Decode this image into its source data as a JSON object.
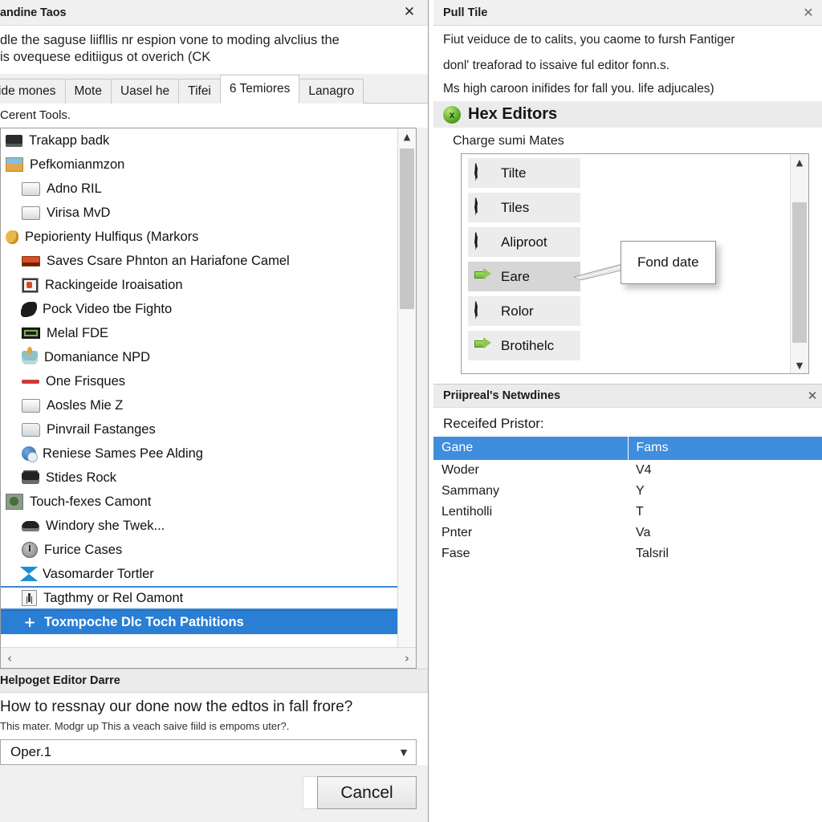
{
  "left_dialog": {
    "title": "andine Taos",
    "close_icon": "close-icon",
    "intro_lines": [
      "dle the saguse liifllis nr espion vone to moding alvclius the",
      "is ovequese editiigus ot overich (CK"
    ],
    "tabs": [
      {
        "label": "ide mones",
        "active": false
      },
      {
        "label": "Mote",
        "active": false
      },
      {
        "label": "Uasel he",
        "active": false
      },
      {
        "label": "Tifei",
        "active": false
      },
      {
        "label": "6 Temiores",
        "active": true
      },
      {
        "label": "Lanagro",
        "active": false
      }
    ],
    "section_note": "Cerent Tools.",
    "tree_items": [
      {
        "label": "Trakapp badk",
        "icon": "printer-icon",
        "indent": 0,
        "state": "normal"
      },
      {
        "label": "Pefkomianmzon",
        "icon": "image-icon",
        "indent": 0,
        "state": "normal"
      },
      {
        "label": "Adno RIL",
        "icon": "blank-page-icon",
        "indent": 1,
        "state": "normal"
      },
      {
        "label": "Virisa MvD",
        "icon": "blank-page-icon",
        "indent": 1,
        "state": "normal"
      },
      {
        "label": "Pepiorienty Hulfiqus (Markors",
        "icon": "hand-icon",
        "indent": 0,
        "state": "normal"
      },
      {
        "label": "Saves Csare Phnton an Hariafone Camel",
        "icon": "red-bar-icon",
        "indent": 1,
        "state": "normal"
      },
      {
        "label": "Rackingeide Iroaisation",
        "icon": "framed-photo-icon",
        "indent": 1,
        "state": "normal"
      },
      {
        "label": "Pock Video tbe Fighto",
        "icon": "splat-icon",
        "indent": 1,
        "state": "normal"
      },
      {
        "label": "Melal FDE",
        "icon": "green-bar-icon",
        "indent": 1,
        "state": "normal"
      },
      {
        "label": "Domaniance NPD",
        "icon": "lamp-icon",
        "indent": 1,
        "state": "normal"
      },
      {
        "label": "One Frisques",
        "icon": "red-line-icon",
        "indent": 1,
        "state": "normal"
      },
      {
        "label": "Aosles Mie Z",
        "icon": "blank-page-icon",
        "indent": 1,
        "state": "normal"
      },
      {
        "label": "Pinvrail Fastanges",
        "icon": "folder-icon",
        "indent": 1,
        "state": "normal"
      },
      {
        "label": "Reniese Sames Pee Alding",
        "icon": "disc-icon",
        "indent": 1,
        "state": "normal"
      },
      {
        "label": "Stides Rock",
        "icon": "printer-alt-icon",
        "indent": 1,
        "state": "normal"
      },
      {
        "label": "Touch-fexes Camont",
        "icon": "green-square-icon",
        "indent": 0,
        "state": "normal"
      },
      {
        "label": "Windory she Twek...",
        "icon": "scanner-icon",
        "indent": 1,
        "state": "normal"
      },
      {
        "label": "Furice Cases",
        "icon": "clock-icon",
        "indent": 1,
        "state": "normal"
      },
      {
        "label": "Vasomarder Tortler",
        "icon": "diamond-icon",
        "indent": 1,
        "state": "normal"
      },
      {
        "label": "Tagthmy or Rel Oamont",
        "icon": "person-icon",
        "indent": 1,
        "state": "preselect"
      },
      {
        "label": "Toxmpoche Dlc Toch Pathitions",
        "icon": "plus-icon",
        "indent": 1,
        "state": "selected"
      }
    ],
    "scroll_up_icon": "chevron-up-icon",
    "hscroll_left_icon": "chevron-left-icon",
    "hscroll_right_icon": "chevron-right-icon",
    "help": {
      "header": "Helpoget Editor Darre",
      "question": "How to ressnay our done now the edtos in fall frore?",
      "subtext": "This mater. Modgr up This a veach saive fiild is empoms uter?.",
      "combo_value": "Oper.1",
      "combo_caret_icon": "chevron-down-icon"
    },
    "cancel_label": "Cancel"
  },
  "right_pane": {
    "title": "Pull Tile",
    "close_icon": "close-icon",
    "intro_lines": [
      "Fiut veiduce de to calits, you caome to fursh Fantiger",
      "donl' treaforad to issaive ful editor fonn.s.",
      "Ms high caroon inifides for fall you. life adjucales)"
    ],
    "hex_section": {
      "icon": "green-ball-icon",
      "title": "Hex Editors",
      "charge_label": "Charge sumi Mates",
      "items": [
        {
          "label": "Tilte",
          "icon": "star-icon",
          "active": false
        },
        {
          "label": "Tiles",
          "icon": "star-icon",
          "active": false
        },
        {
          "label": "Aliproot",
          "icon": "star-icon",
          "active": false
        },
        {
          "label": "Eare",
          "icon": "green-arrow-icon",
          "active": true
        },
        {
          "label": "Rolor",
          "icon": "star-icon",
          "active": false
        },
        {
          "label": "Brotihelc",
          "icon": "green-arrow-icon",
          "active": false
        }
      ],
      "scroll_up_icon": "chevron-up-icon",
      "scroll_down_icon": "chevron-down-icon",
      "tooltip": "Fond date"
    },
    "prefs_section": {
      "header": "Priipreal's Netwdines",
      "close_icon": "close-icon",
      "received_label": "Receifed Pristor:",
      "columns": [
        "Gane",
        "Fams"
      ],
      "rows": [
        [
          "Woder",
          "V4"
        ],
        [
          "Sammany",
          "Y"
        ],
        [
          "Lentiholli",
          "T"
        ],
        [
          "Pnter",
          "Va"
        ],
        [
          "Fase",
          "Talsril"
        ]
      ]
    }
  },
  "colors": {
    "accent_blue": "#2a7fd4",
    "header_blue": "#3f8ddd",
    "window_gray": "#f0f0f0",
    "band_gray": "#ebebeb",
    "green": "#6fb82f"
  }
}
